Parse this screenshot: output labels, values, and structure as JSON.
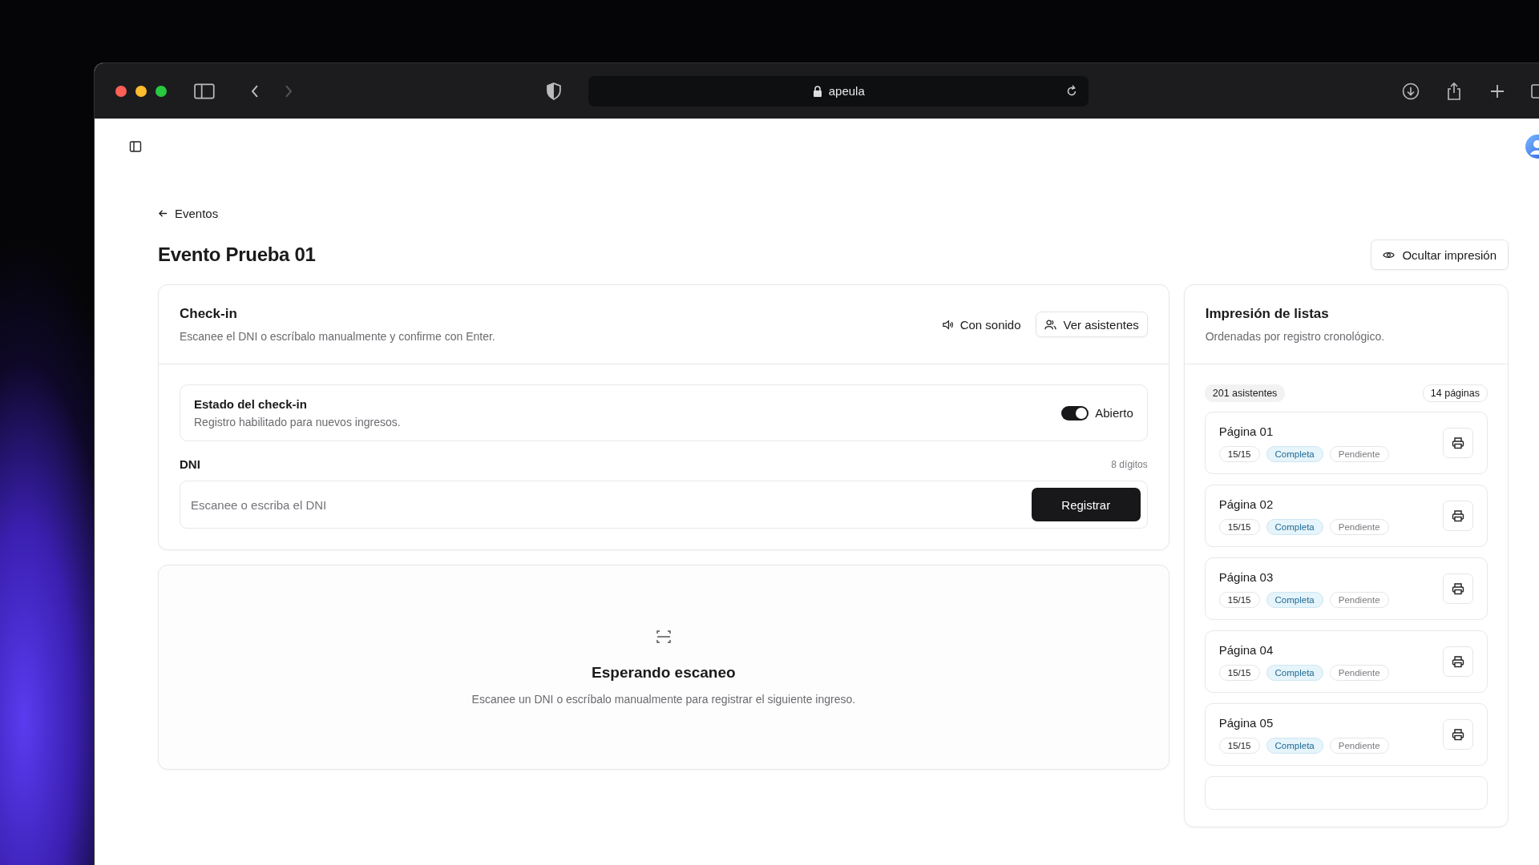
{
  "browser": {
    "url": "apeula"
  },
  "back_link": "Eventos",
  "title": "Evento Prueba 01",
  "hide_print_button": "Ocultar impresión",
  "checkin": {
    "title": "Check-in",
    "subtitle": "Escanee el DNI o escríbalo manualmente y confirme con Enter.",
    "sound_button": "Con sonido",
    "attendees_button": "Ver asistentes",
    "status": {
      "title": "Estado del check-in",
      "subtitle": "Registro habilitado para nuevos ingresos.",
      "on": true,
      "label": "Abierto"
    },
    "field": {
      "label": "DNI",
      "hint": "8 dígitos",
      "placeholder": "Escanee o escriba el DNI",
      "button": "Registrar"
    }
  },
  "scan": {
    "title": "Esperando escaneo",
    "text": "Escanee un DNI o escríbalo manualmente para registrar el siguiente ingreso."
  },
  "print_lists": {
    "title": "Impresión de listas",
    "subtitle": "Ordenadas por registro cronológico.",
    "attendees": "201 asistentes",
    "pages_count": "14 páginas",
    "pages": [
      {
        "name": "Página 01",
        "count": "15/15",
        "badges": [
          {
            "label": "Completa",
            "active": true
          },
          {
            "label": "Pendiente",
            "active": false
          }
        ]
      },
      {
        "name": "Página 02",
        "count": "15/15",
        "badges": [
          {
            "label": "Completa",
            "active": true
          },
          {
            "label": "Pendiente",
            "active": false
          }
        ]
      },
      {
        "name": "Página 03",
        "count": "15/15",
        "badges": [
          {
            "label": "Completa",
            "active": true
          },
          {
            "label": "Pendiente",
            "active": false
          }
        ]
      },
      {
        "name": "Página 04",
        "count": "15/15",
        "badges": [
          {
            "label": "Completa",
            "active": true
          },
          {
            "label": "Pendiente",
            "active": false
          }
        ]
      },
      {
        "name": "Página 05",
        "count": "15/15",
        "badges": [
          {
            "label": "Completa",
            "active": true
          },
          {
            "label": "Pendiente",
            "active": false
          }
        ]
      }
    ]
  }
}
